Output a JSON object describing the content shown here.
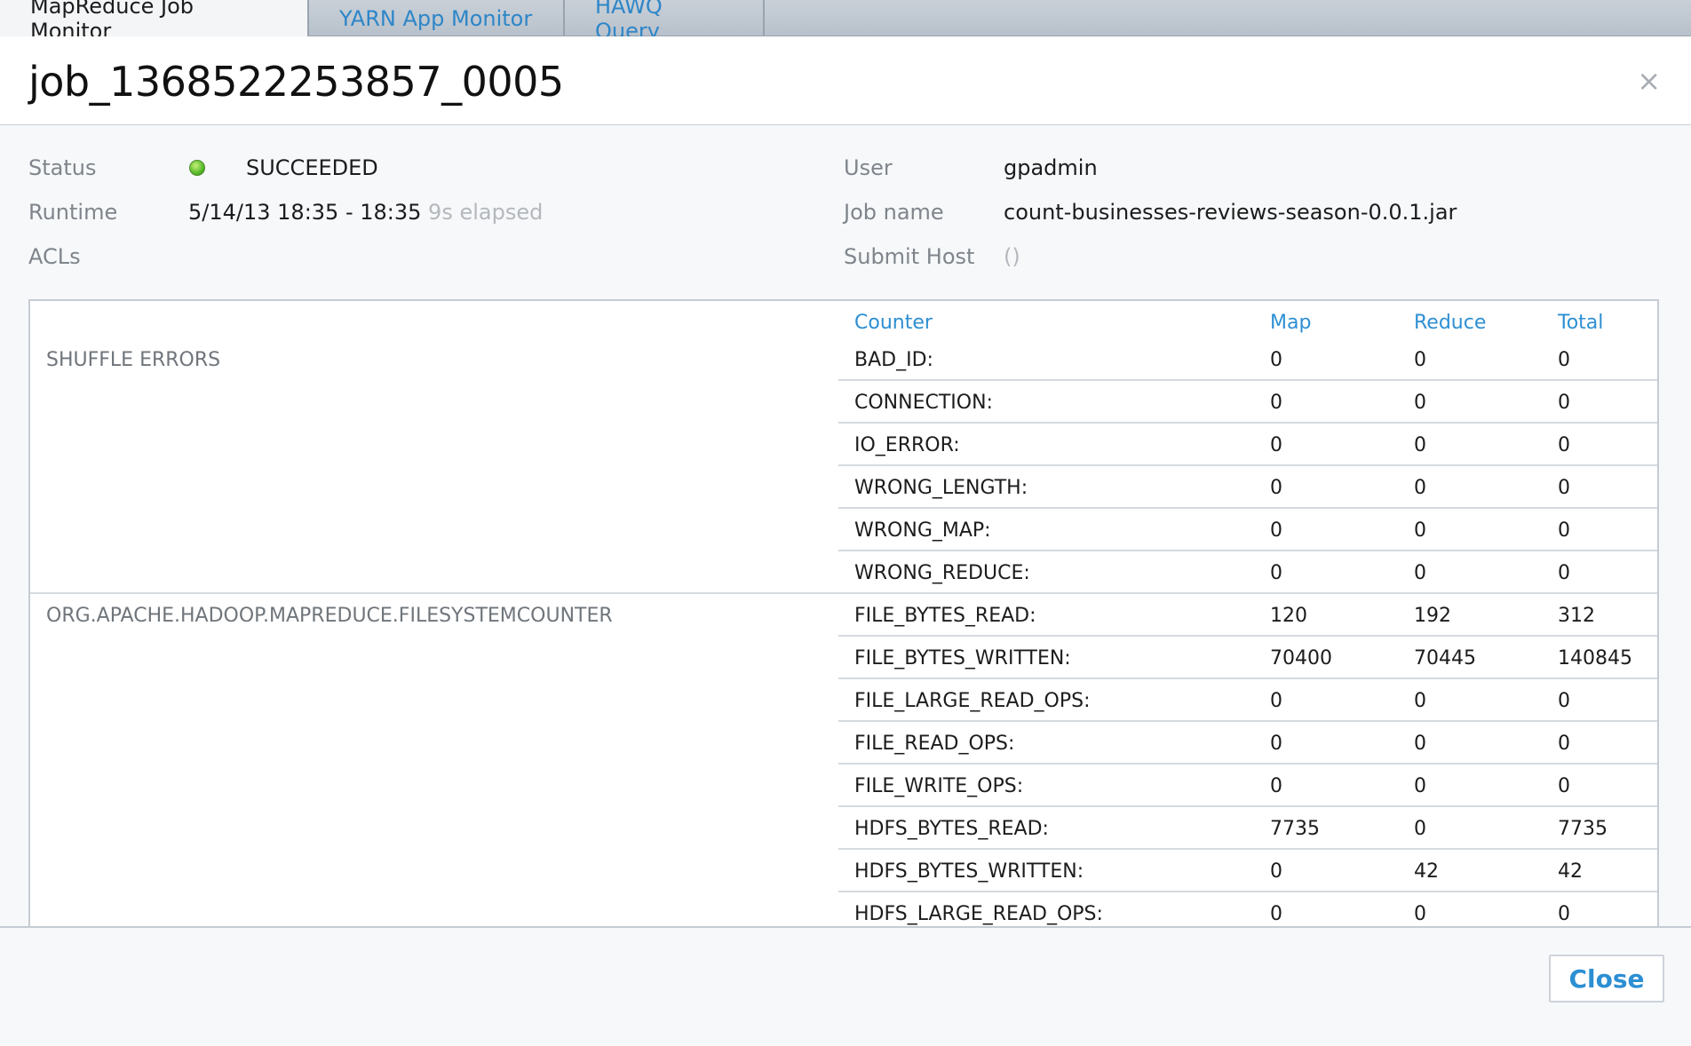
{
  "tabs": [
    {
      "label": "MapReduce Job Monitor"
    },
    {
      "label": "YARN App Monitor"
    },
    {
      "label": "HAWQ Query"
    }
  ],
  "header": {
    "job_id": "job_1368522253857_0005",
    "close_icon": "×"
  },
  "info": {
    "status_label": "Status",
    "status_value": "SUCCEEDED",
    "status_color": "#58b82a",
    "runtime_label": "Runtime",
    "runtime_value": "5/14/13 18:35 - 18:35",
    "runtime_elapsed": "9s elapsed",
    "acls_label": "ACLs",
    "user_label": "User",
    "user_value": "gpadmin",
    "jobname_label": "Job name",
    "jobname_value": "count-businesses-reviews-season-0.0.1.jar",
    "submithost_label": "Submit Host",
    "submithost_value": "()"
  },
  "counters": {
    "headers": {
      "counter": "Counter",
      "map": "Map",
      "reduce": "Reduce",
      "total": "Total"
    },
    "groups": [
      {
        "name": "SHUFFLE ERRORS",
        "rows": [
          {
            "counter": "BAD_ID:",
            "map": "0",
            "reduce": "0",
            "total": "0"
          },
          {
            "counter": "CONNECTION:",
            "map": "0",
            "reduce": "0",
            "total": "0"
          },
          {
            "counter": "IO_ERROR:",
            "map": "0",
            "reduce": "0",
            "total": "0"
          },
          {
            "counter": "WRONG_LENGTH:",
            "map": "0",
            "reduce": "0",
            "total": "0"
          },
          {
            "counter": "WRONG_MAP:",
            "map": "0",
            "reduce": "0",
            "total": "0"
          },
          {
            "counter": "WRONG_REDUCE:",
            "map": "0",
            "reduce": "0",
            "total": "0"
          }
        ]
      },
      {
        "name": "ORG.APACHE.HADOOP.MAPREDUCE.FILESYSTEMCOUNTER",
        "rows": [
          {
            "counter": "FILE_BYTES_READ:",
            "map": "120",
            "reduce": "192",
            "total": "312"
          },
          {
            "counter": "FILE_BYTES_WRITTEN:",
            "map": "70400",
            "reduce": "70445",
            "total": "140845"
          },
          {
            "counter": "FILE_LARGE_READ_OPS:",
            "map": "0",
            "reduce": "0",
            "total": "0"
          },
          {
            "counter": "FILE_READ_OPS:",
            "map": "0",
            "reduce": "0",
            "total": "0"
          },
          {
            "counter": "FILE_WRITE_OPS:",
            "map": "0",
            "reduce": "0",
            "total": "0"
          },
          {
            "counter": "HDFS_BYTES_READ:",
            "map": "7735",
            "reduce": "0",
            "total": "7735"
          },
          {
            "counter": "HDFS_BYTES_WRITTEN:",
            "map": "0",
            "reduce": "42",
            "total": "42"
          },
          {
            "counter": "HDFS_LARGE_READ_OPS:",
            "map": "0",
            "reduce": "0",
            "total": "0"
          }
        ]
      }
    ]
  },
  "footer": {
    "close_label": "Close"
  }
}
